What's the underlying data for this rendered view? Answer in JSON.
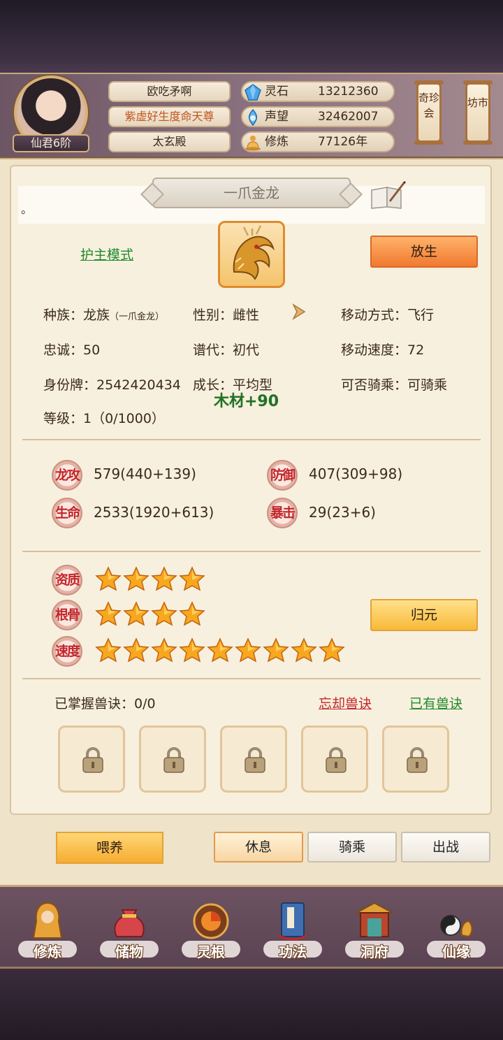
{
  "header": {
    "player_rank": "仙君6阶",
    "player_name": "欧吃矛啊",
    "player_title": "紫虚好生度命天尊",
    "player_sect": "太玄殿",
    "resources": [
      {
        "icon": "spirit-stone-icon",
        "label": "灵石",
        "value": "13212360"
      },
      {
        "icon": "reputation-icon",
        "label": "声望",
        "value": "32462007"
      },
      {
        "icon": "cultivation-icon",
        "label": "修炼",
        "value": "77126年"
      }
    ],
    "banner_market": "奇珍会",
    "banner_shop": "坊市"
  },
  "pet": {
    "name": "一爪金龙",
    "note": "。",
    "mode_link": "护主模式",
    "release_button": "放生",
    "info": {
      "race_label": "种族：",
      "race_value": "龙族",
      "race_sub": "（一爪金龙）",
      "gender": "性别：雌性",
      "move_type": "移动方式：飞行",
      "loyalty": "忠诚：50",
      "generation": "谱代：初代",
      "move_speed": "移动速度：72",
      "id_tag": "身份牌：2542420434",
      "growth": "成长：平均型",
      "rideable": "可否骑乘：可骑乘",
      "level": "等级：1（0/1000）"
    },
    "float_text": "木材+90",
    "stats": [
      {
        "badge": "龙攻",
        "value": "579(440+139)"
      },
      {
        "badge": "防御",
        "value": "407(309+98)"
      },
      {
        "badge": "生命",
        "value": "2533(1920+613)"
      },
      {
        "badge": "暴击",
        "value": "29(23+6)"
      }
    ],
    "aptitude": [
      {
        "badge": "资质",
        "stars": 4
      },
      {
        "badge": "根骨",
        "stars": 4
      },
      {
        "badge": "速度",
        "stars": 9
      }
    ],
    "restore_button": "归元",
    "skills_label": "已掌握兽诀：0/0",
    "forget_link": "忘却兽诀",
    "owned_link": "已有兽诀",
    "skill_slots_locked": 5
  },
  "actions": {
    "feed": "喂养",
    "rest": "休息",
    "ride": "骑乘",
    "battle": "出战",
    "active_tab": "rest"
  },
  "nav": [
    {
      "icon": "cultivate-icon",
      "label": "修炼"
    },
    {
      "icon": "storage-bag-icon",
      "label": "储物"
    },
    {
      "icon": "spirit-root-icon",
      "label": "灵根"
    },
    {
      "icon": "technique-book-icon",
      "label": "功法"
    },
    {
      "icon": "cave-mansion-icon",
      "label": "洞府"
    },
    {
      "icon": "immortal-fate-icon",
      "label": "仙缘"
    }
  ],
  "colors": {
    "accent_orange": "#f0792f",
    "gold": "#f8b93a",
    "link_green": "#1e8a2a",
    "link_red": "#c2262b",
    "panel_bg": "#f8f0de"
  }
}
